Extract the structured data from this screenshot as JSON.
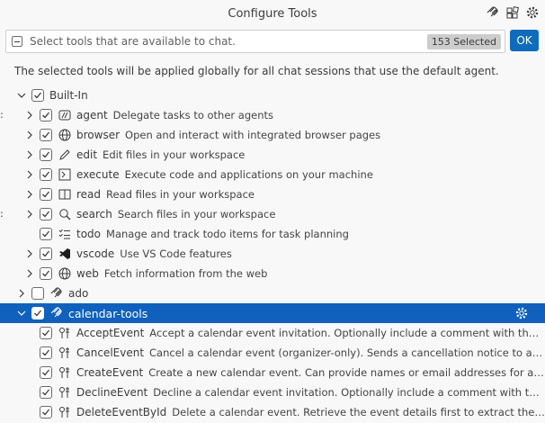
{
  "window": {
    "title": "Configure Tools"
  },
  "search": {
    "placeholder": "Select tools that are available to chat.",
    "selected_count": "153 Selected"
  },
  "ok_label": "OK",
  "description": "The selected tools will be applied globally for all chat sessions that use the default agent.",
  "colors": {
    "accent": "#0f6cbd",
    "selected_row": "#0f61bd"
  },
  "tree": {
    "builtin": {
      "label": "Built-In",
      "items": [
        {
          "name": "agent",
          "description": "Delegate tasks to other agents",
          "icon": "agent-icon"
        },
        {
          "name": "browser",
          "description": "Open and interact with integrated browser pages",
          "icon": "globe-icon"
        },
        {
          "name": "edit",
          "description": "Edit files in your workspace",
          "icon": "pencil-icon"
        },
        {
          "name": "execute",
          "description": "Execute code and applications on your machine",
          "icon": "terminal-icon"
        },
        {
          "name": "read",
          "description": "Read files in your workspace",
          "icon": "book-icon"
        },
        {
          "name": "search",
          "description": "Search files in your workspace",
          "icon": "search-icon"
        },
        {
          "name": "todo",
          "description": "Manage and track todo items for task planning",
          "icon": "checklist-icon"
        },
        {
          "name": "vscode",
          "description": "Use VS Code features",
          "icon": "vscode-icon"
        },
        {
          "name": "web",
          "description": "Fetch information from the web",
          "icon": "globe-icon"
        }
      ]
    },
    "ado": {
      "label": "ado"
    },
    "calendar": {
      "label": "calendar-tools",
      "items": [
        {
          "name": "AcceptEvent",
          "description": "Accept a calendar event invitation. Optionally include a comment with the accepta..."
        },
        {
          "name": "CancelEvent",
          "description": "Cancel a calendar event (organizer-only). Sends a cancellation notice to all attende..."
        },
        {
          "name": "CreateEvent",
          "description": "Create a new calendar event. Can provide names or email addresses for attendees ..."
        },
        {
          "name": "DeclineEvent",
          "description": "Decline a calendar event invitation. Optionally include a comment with the decline."
        },
        {
          "name": "DeleteEventById",
          "description": "Delete a calendar event. Retrieve the event details first to extract the ID, then ..."
        }
      ]
    }
  }
}
